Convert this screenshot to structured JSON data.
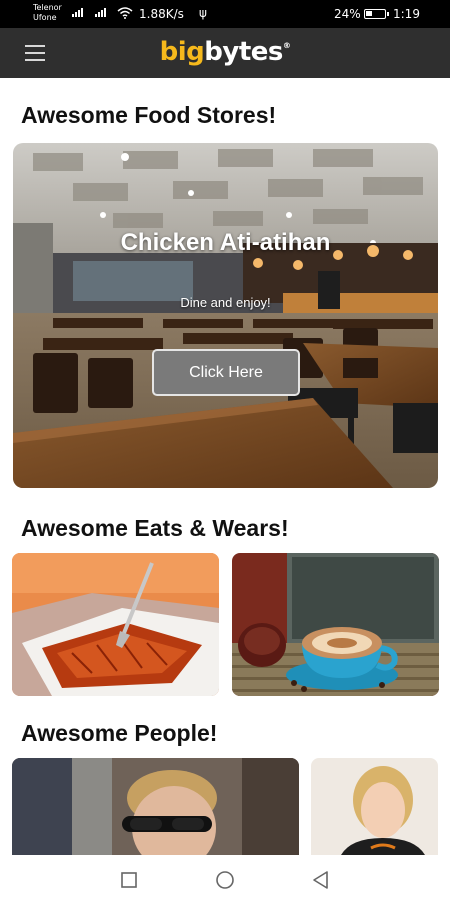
{
  "status_bar": {
    "carrier_line1": "Telenor",
    "carrier_line2": "Ufone",
    "net_speed": "1.88K/s",
    "usb_symbol": "ψ",
    "battery_pct": "24%",
    "time": "1:19"
  },
  "app_bar": {
    "brand_part1": "big",
    "brand_part2": "bytes",
    "brand_mark": "®"
  },
  "sections": {
    "food_stores_title": "Awesome Food Stores!",
    "eats_wears_title": "Awesome Eats & Wears!",
    "people_title": "Awesome People!"
  },
  "hero": {
    "title": "Chicken Ati-atihan",
    "subtitle": "Dine and enjoy!",
    "button_label": "Click Here"
  },
  "colors": {
    "brand_yellow": "#f6b91c",
    "app_bar_bg": "#2f2f2f",
    "button_gray": "#7a7a7a"
  },
  "icons": {
    "menu": "hamburger-menu-icon",
    "nav_recent": "square-icon",
    "nav_home": "circle-icon",
    "nav_back": "triangle-back-icon"
  }
}
